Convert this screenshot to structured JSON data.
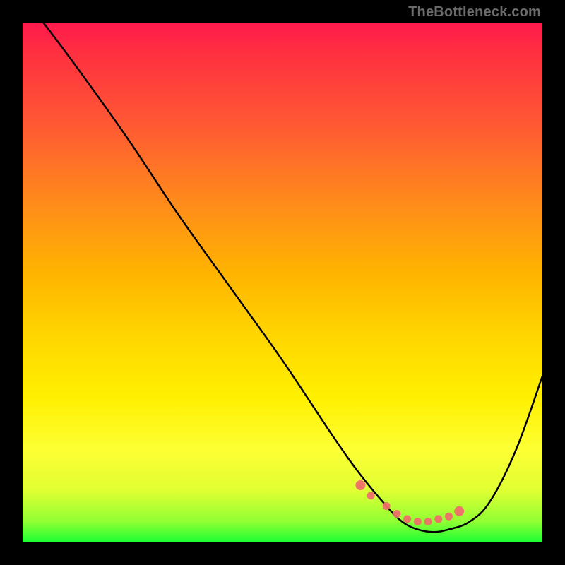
{
  "watermark": "TheBottleneck.com",
  "colors": {
    "frame_bg": "#000000",
    "gradient_stops": [
      "#ff1a4d",
      "#ff3040",
      "#ff5a33",
      "#ff8c1a",
      "#ffb300",
      "#ffd500",
      "#fff000",
      "#fdff33",
      "#e0ff33",
      "#90ff33",
      "#1aff33"
    ],
    "curve_stroke": "#000000",
    "marker_fill": "#ef6f6a"
  },
  "chart_data": {
    "type": "line",
    "title": "",
    "xlabel": "",
    "ylabel": "",
    "xlim": [
      0,
      100
    ],
    "ylim": [
      0,
      100
    ],
    "grid": false,
    "legend": false,
    "series": [
      {
        "name": "bottleneck-curve",
        "x": [
          4,
          10,
          20,
          30,
          40,
          50,
          60,
          65,
          70,
          73,
          76,
          79,
          82,
          86,
          90,
          95,
          100
        ],
        "y": [
          100,
          92,
          78,
          63,
          49,
          35,
          20,
          13,
          7,
          4,
          2.5,
          2,
          2.5,
          4,
          8,
          18,
          32
        ]
      }
    ],
    "markers": {
      "description": "highlighted optimal-range dots near curve minimum",
      "points": [
        {
          "x": 65,
          "y": 11
        },
        {
          "x": 67,
          "y": 9
        },
        {
          "x": 70,
          "y": 7
        },
        {
          "x": 72,
          "y": 5.5
        },
        {
          "x": 74,
          "y": 4.5
        },
        {
          "x": 76,
          "y": 4
        },
        {
          "x": 78,
          "y": 4
        },
        {
          "x": 80,
          "y": 4.5
        },
        {
          "x": 82,
          "y": 5
        },
        {
          "x": 84,
          "y": 6
        }
      ]
    }
  }
}
